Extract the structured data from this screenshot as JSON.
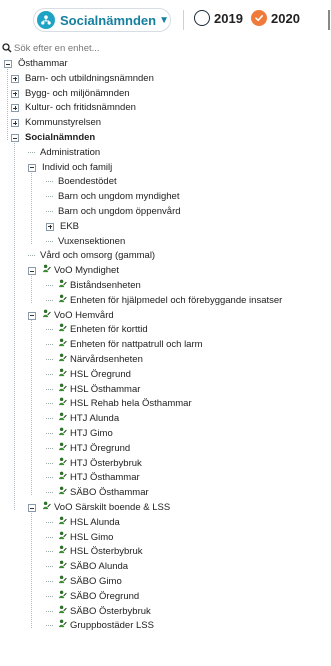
{
  "header": {
    "org_selector": {
      "label": "Socialnämnden",
      "icon": "organization-icon"
    },
    "years": [
      {
        "label": "2019",
        "selected": false
      },
      {
        "label": "2020",
        "selected": true
      }
    ],
    "colors": {
      "accent": "#157fa0",
      "selected_year": "#f07a3a",
      "org_icon_bg": "#1fa3c4"
    }
  },
  "search": {
    "placeholder": "Sök efter en enhet..."
  },
  "tree": [
    {
      "label": "Östhammar",
      "toggle": "minus",
      "depth": 0
    },
    {
      "label": "Barn- och utbildningsnämnden",
      "toggle": "plus",
      "depth": 1
    },
    {
      "label": "Bygg- och miljönämnden",
      "toggle": "plus",
      "depth": 1
    },
    {
      "label": "Kultur- och fritidsnämnden",
      "toggle": "plus",
      "depth": 1
    },
    {
      "label": "Kommunstyrelsen",
      "toggle": "plus",
      "depth": 1
    },
    {
      "label": "Socialnämnden",
      "toggle": "minus",
      "depth": 1,
      "bold": true
    },
    {
      "label": "Administration",
      "toggle": "none",
      "depth": 2
    },
    {
      "label": "Individ och familj",
      "toggle": "minus",
      "depth": 2
    },
    {
      "label": "Boendestödet",
      "toggle": "none",
      "depth": 3
    },
    {
      "label": "Barn och ungdom myndighet",
      "toggle": "none",
      "depth": 3
    },
    {
      "label": "Barn och ungdom öppenvård",
      "toggle": "none",
      "depth": 3
    },
    {
      "label": "EKB",
      "toggle": "plus",
      "depth": 3
    },
    {
      "label": "Vuxensektionen",
      "toggle": "none",
      "depth": 3
    },
    {
      "label": "Vård och omsorg (gammal)",
      "toggle": "none",
      "depth": 2
    },
    {
      "label": "VoO Myndighet",
      "toggle": "minus",
      "depth": 2,
      "person": true
    },
    {
      "label": "Biståndsenheten",
      "toggle": "none",
      "depth": 3,
      "person": true
    },
    {
      "label": "Enheten för hjälpmedel och förebyggande insatser",
      "toggle": "none",
      "depth": 3,
      "person": true
    },
    {
      "label": "VoO Hemvård",
      "toggle": "minus",
      "depth": 2,
      "person": true
    },
    {
      "label": "Enheten för korttid",
      "toggle": "none",
      "depth": 3,
      "person": true
    },
    {
      "label": "Enheten för nattpatrull och larm",
      "toggle": "none",
      "depth": 3,
      "person": true
    },
    {
      "label": "Närvårdsenheten",
      "toggle": "none",
      "depth": 3,
      "person": true
    },
    {
      "label": "HSL Öregrund",
      "toggle": "none",
      "depth": 3,
      "person": true
    },
    {
      "label": "HSL Östhammar",
      "toggle": "none",
      "depth": 3,
      "person": true
    },
    {
      "label": "HSL Rehab hela Östhammar",
      "toggle": "none",
      "depth": 3,
      "person": true
    },
    {
      "label": "HTJ Alunda",
      "toggle": "none",
      "depth": 3,
      "person": true
    },
    {
      "label": "HTJ Gimo",
      "toggle": "none",
      "depth": 3,
      "person": true
    },
    {
      "label": "HTJ Öregrund",
      "toggle": "none",
      "depth": 3,
      "person": true
    },
    {
      "label": "HTJ Österbybruk",
      "toggle": "none",
      "depth": 3,
      "person": true
    },
    {
      "label": "HTJ Östhammar",
      "toggle": "none",
      "depth": 3,
      "person": true
    },
    {
      "label": "SÄBO Östhammar",
      "toggle": "none",
      "depth": 3,
      "person": true
    },
    {
      "label": "VoO Särskilt boende & LSS",
      "toggle": "minus",
      "depth": 2,
      "person": true
    },
    {
      "label": "HSL Alunda",
      "toggle": "none",
      "depth": 3,
      "person": true
    },
    {
      "label": "HSL Gimo",
      "toggle": "none",
      "depth": 3,
      "person": true
    },
    {
      "label": "HSL Österbybruk",
      "toggle": "none",
      "depth": 3,
      "person": true
    },
    {
      "label": "SÄBO Alunda",
      "toggle": "none",
      "depth": 3,
      "person": true
    },
    {
      "label": "SÄBO Gimo",
      "toggle": "none",
      "depth": 3,
      "person": true
    },
    {
      "label": "SÄBO Öregrund",
      "toggle": "none",
      "depth": 3,
      "person": true
    },
    {
      "label": "SÄBO Österbybruk",
      "toggle": "none",
      "depth": 3,
      "person": true
    },
    {
      "label": "Gruppbostäder LSS",
      "toggle": "none",
      "depth": 3,
      "person": true
    }
  ]
}
